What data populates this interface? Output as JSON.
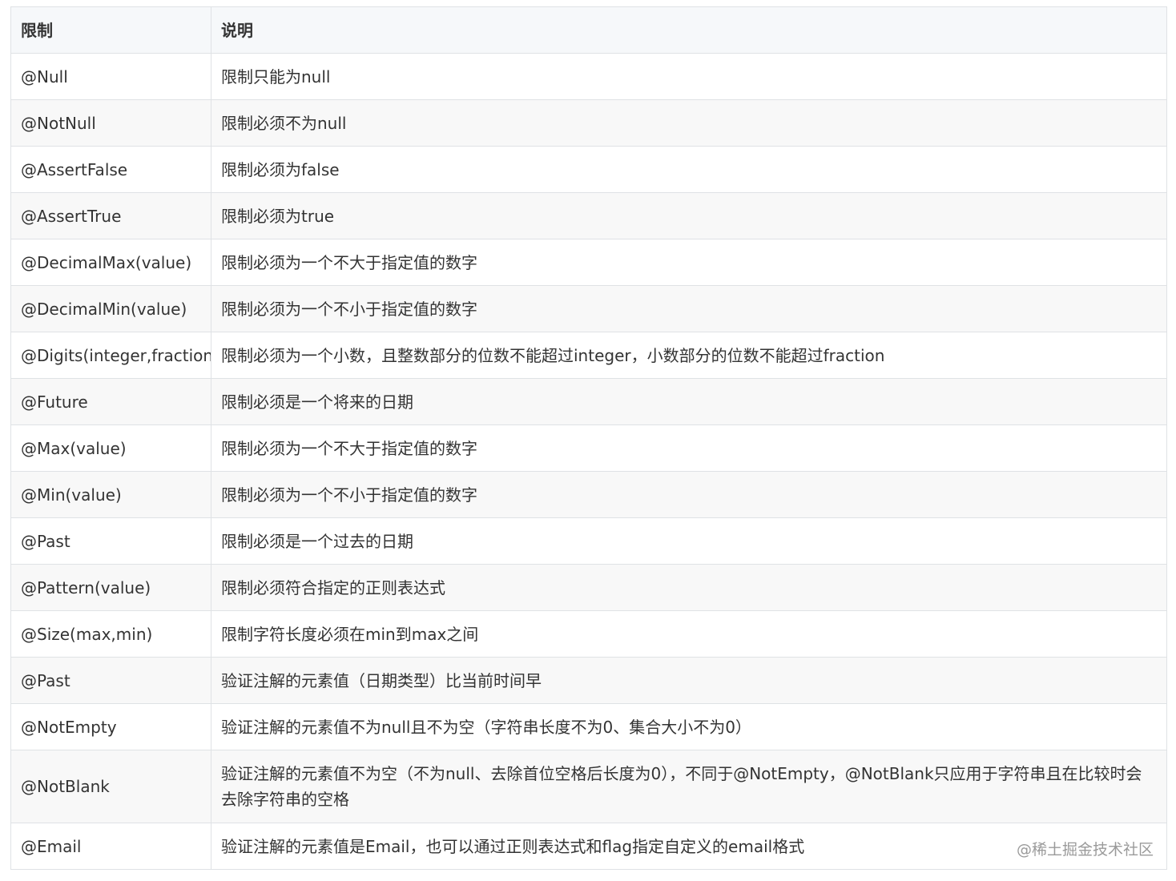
{
  "table": {
    "headers": [
      "限制",
      "说明"
    ],
    "rows": [
      {
        "annotation": "@Null",
        "description": "限制只能为null"
      },
      {
        "annotation": "@NotNull",
        "description": "限制必须不为null"
      },
      {
        "annotation": "@AssertFalse",
        "description": "限制必须为false"
      },
      {
        "annotation": "@AssertTrue",
        "description": "限制必须为true"
      },
      {
        "annotation": "@DecimalMax(value)",
        "description": "限制必须为一个不大于指定值的数字"
      },
      {
        "annotation": "@DecimalMin(value)",
        "description": "限制必须为一个不小于指定值的数字"
      },
      {
        "annotation": "@Digits(integer,fraction)",
        "description": "限制必须为一个小数，且整数部分的位数不能超过integer，小数部分的位数不能超过fraction"
      },
      {
        "annotation": "@Future",
        "description": "限制必须是一个将来的日期"
      },
      {
        "annotation": "@Max(value)",
        "description": "限制必须为一个不大于指定值的数字"
      },
      {
        "annotation": "@Min(value)",
        "description": "限制必须为一个不小于指定值的数字"
      },
      {
        "annotation": "@Past",
        "description": "限制必须是一个过去的日期"
      },
      {
        "annotation": "@Pattern(value)",
        "description": "限制必须符合指定的正则表达式"
      },
      {
        "annotation": "@Size(max,min)",
        "description": "限制字符长度必须在min到max之间"
      },
      {
        "annotation": "@Past",
        "description": "验证注解的元素值（日期类型）比当前时间早"
      },
      {
        "annotation": "@NotEmpty",
        "description": "验证注解的元素值不为null且不为空（字符串长度不为0、集合大小不为0）"
      },
      {
        "annotation": "@NotBlank",
        "description": "验证注解的元素值不为空（不为null、去除首位空格后长度为0），不同于@NotEmpty，@NotBlank只应用于字符串且在比较时会去除字符串的空格"
      },
      {
        "annotation": "@Email",
        "description": "验证注解的元素值是Email，也可以通过正则表达式和flag指定自定义的email格式"
      }
    ]
  },
  "watermark": "@稀土掘金技术社区"
}
